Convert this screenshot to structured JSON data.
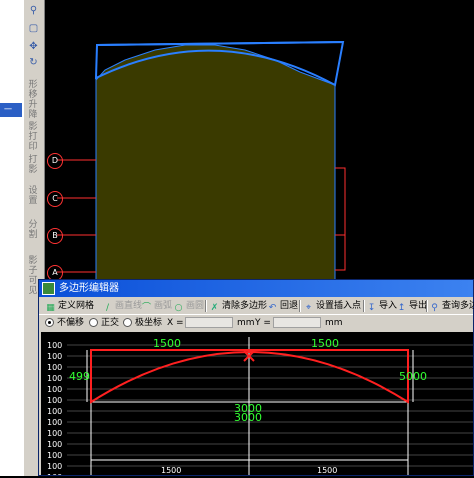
{
  "left_panel": {
    "active_label": "一"
  },
  "toolbar": {
    "vertical_labels": [
      "形移升降",
      "影打印",
      "打影",
      "设置",
      "分割",
      "影子可见"
    ]
  },
  "cad": {
    "axes": [
      "D",
      "C",
      "B",
      "A"
    ],
    "colors": {
      "fill": "#3a3a00",
      "outline_blue": "#2a7fff",
      "axis_red": "#ff3030"
    }
  },
  "dialog": {
    "title": "多边形编辑器",
    "toolbar": [
      {
        "label": "定义网格",
        "icon": "grid-icon",
        "enabled": true
      },
      {
        "label": "画直线",
        "icon": "line-icon",
        "enabled": false
      },
      {
        "label": "画弧",
        "icon": "arc-icon",
        "enabled": false
      },
      {
        "label": "画圆",
        "icon": "circle-icon",
        "enabled": false
      },
      {
        "label": "清除多边形",
        "icon": "clear-icon",
        "enabled": true
      },
      {
        "label": "回退",
        "icon": "undo-icon",
        "enabled": true
      },
      {
        "label": "设置插入点",
        "icon": "insert-point-icon",
        "enabled": true
      },
      {
        "label": "导入",
        "icon": "import-icon",
        "enabled": true
      },
      {
        "label": "导出",
        "icon": "export-icon",
        "enabled": true
      },
      {
        "label": "查询多边",
        "icon": "search-icon",
        "enabled": true
      }
    ],
    "options": {
      "radios": [
        "不偏移",
        "正交",
        "极坐标"
      ],
      "selected": 0,
      "x_label": "X =",
      "y_label": "Y =",
      "x_unit": "mm",
      "y_unit": "mm"
    },
    "drawing": {
      "left_rows": [
        "100",
        "100",
        "100",
        "100",
        "100",
        "100",
        "100",
        "100",
        "100",
        "100",
        "100",
        "100",
        "100"
      ],
      "top_dims": [
        "1500",
        "1500"
      ],
      "left_dim": "499",
      "right_dim": "5000",
      "center_dims": [
        "3000",
        "3000"
      ],
      "bottom_dims": [
        "1500",
        "1500"
      ]
    }
  }
}
